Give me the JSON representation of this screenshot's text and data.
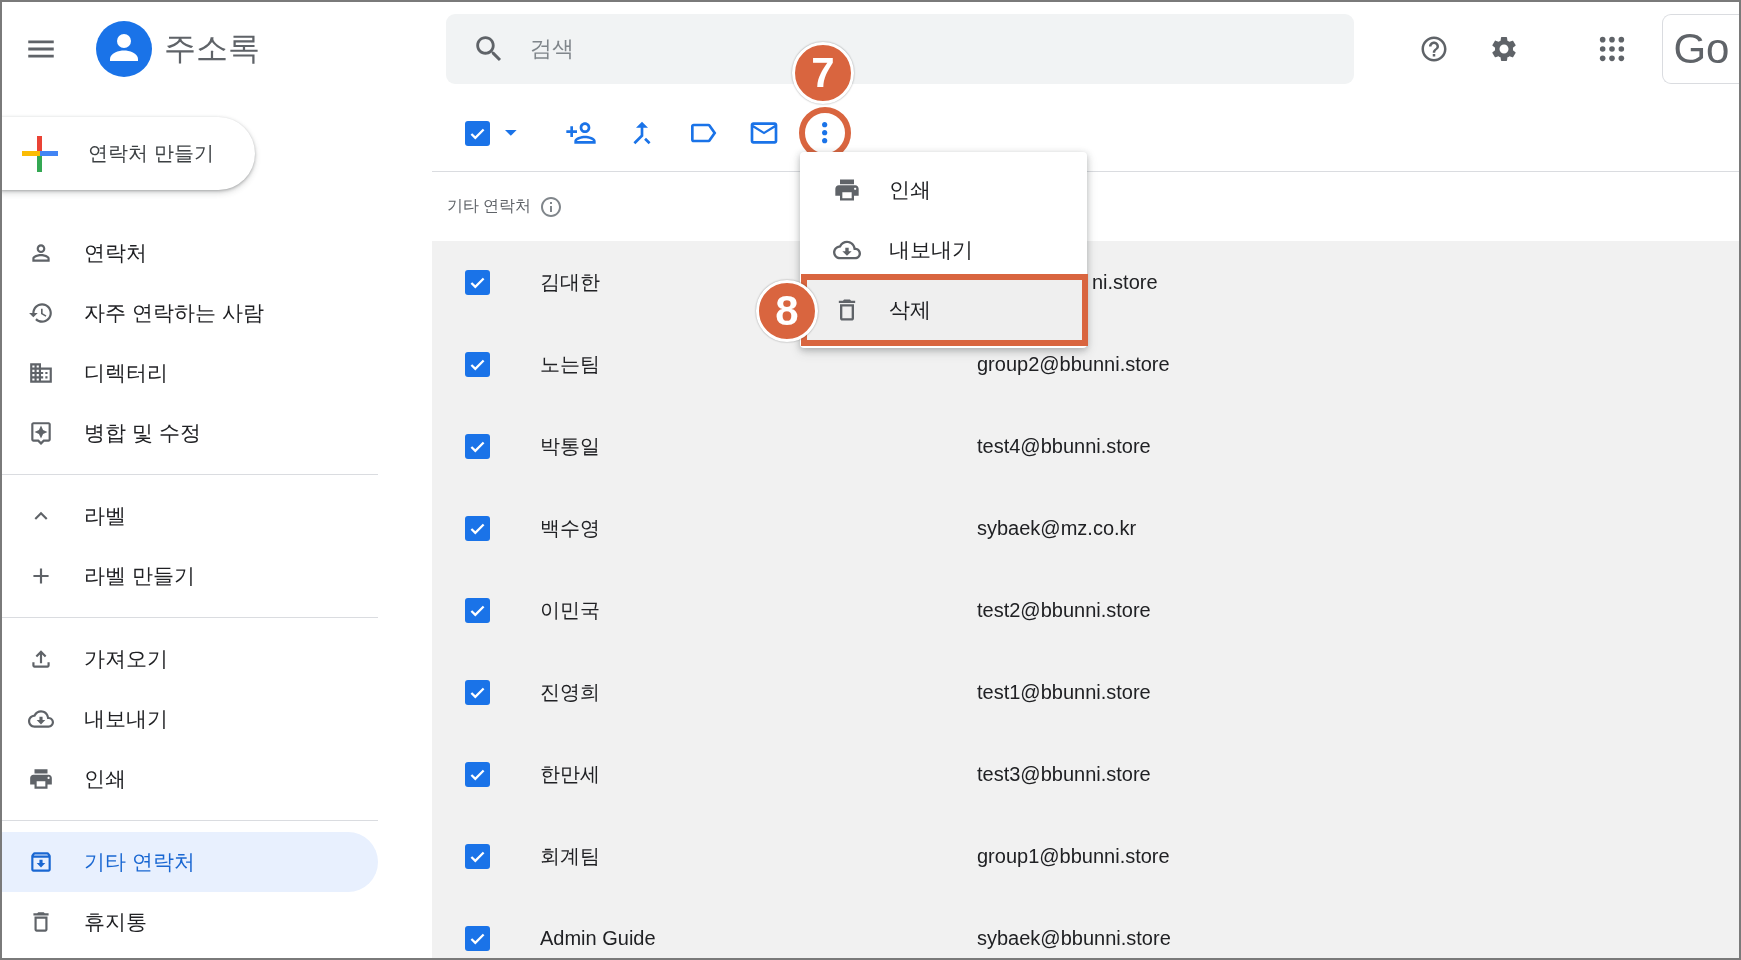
{
  "app": {
    "title": "주소록"
  },
  "search": {
    "placeholder": "검색"
  },
  "brand": {
    "text": "Go"
  },
  "create_button": {
    "label": "연락처 만들기"
  },
  "sidebar": {
    "groups": [
      {
        "items": [
          {
            "kind": "contacts",
            "label": "연락처",
            "selected": false
          },
          {
            "kind": "frequent",
            "label": "자주 연락하는 사람",
            "selected": false
          },
          {
            "kind": "directory",
            "label": "디렉터리",
            "selected": false
          },
          {
            "kind": "fix",
            "label": "병합 및 수정",
            "selected": false
          }
        ]
      },
      {
        "items": [
          {
            "kind": "labels",
            "label": "라벨",
            "selected": false,
            "expanded": true
          },
          {
            "kind": "create-label",
            "label": "라벨 만들기",
            "selected": false
          }
        ]
      },
      {
        "items": [
          {
            "kind": "import",
            "label": "가져오기",
            "selected": false
          },
          {
            "kind": "export",
            "label": "내보내기",
            "selected": false
          },
          {
            "kind": "print",
            "label": "인쇄",
            "selected": false
          }
        ]
      },
      {
        "items": [
          {
            "kind": "other",
            "label": "기타 연락처",
            "selected": true
          },
          {
            "kind": "trash",
            "label": "휴지통",
            "selected": false
          }
        ]
      }
    ]
  },
  "toolbar": {
    "select_all": {
      "checked": true
    },
    "actions": [
      {
        "kind": "add-contact",
        "highlighted": false
      },
      {
        "kind": "merge",
        "highlighted": false
      },
      {
        "kind": "label",
        "highlighted": false
      },
      {
        "kind": "email",
        "highlighted": false
      },
      {
        "kind": "more",
        "highlighted": true
      }
    ]
  },
  "list": {
    "title": "기타 연락처",
    "rows": [
      {
        "name": "김대한",
        "email": "ni.store",
        "checked": true,
        "covered": true
      },
      {
        "name": "노는팀",
        "email": "group2@bbunni.store",
        "checked": true,
        "covered": false
      },
      {
        "name": "박통일",
        "email": "test4@bbunni.store",
        "checked": true,
        "covered": false
      },
      {
        "name": "백수영",
        "email": "sybaek@mz.co.kr",
        "checked": true,
        "covered": false
      },
      {
        "name": "이민국",
        "email": "test2@bbunni.store",
        "checked": true,
        "covered": false
      },
      {
        "name": "진영희",
        "email": "test1@bbunni.store",
        "checked": true,
        "covered": false
      },
      {
        "name": "한만세",
        "email": "test3@bbunni.store",
        "checked": true,
        "covered": false
      },
      {
        "name": "회계팀",
        "email": "group1@bbunni.store",
        "checked": true,
        "covered": false
      },
      {
        "name": "Admin Guide",
        "email": "sybaek@bbunni.store",
        "checked": true,
        "covered": false
      }
    ]
  },
  "menu": {
    "items": [
      {
        "kind": "print",
        "label": "인쇄",
        "highlighted": false
      },
      {
        "kind": "export",
        "label": "내보내기",
        "highlighted": false
      },
      {
        "kind": "delete",
        "label": "삭제",
        "highlighted": true
      }
    ]
  },
  "annotations": [
    {
      "label": "7"
    },
    {
      "label": "8"
    }
  ]
}
